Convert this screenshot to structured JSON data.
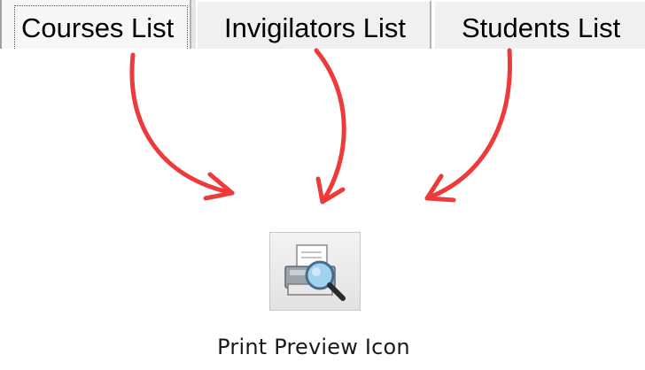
{
  "tabs": [
    {
      "label": "Courses List",
      "selected": true
    },
    {
      "label": "Invigilators List",
      "selected": false
    },
    {
      "label": "Students List",
      "selected": false
    }
  ],
  "toolbar": {
    "print_preview_icon": "print-preview-icon"
  },
  "caption": "Print Preview Icon",
  "colors": {
    "arrow": "#ee3a3a",
    "tab_background": "#f0f0f0",
    "tab_border": "#b4b4b4"
  }
}
